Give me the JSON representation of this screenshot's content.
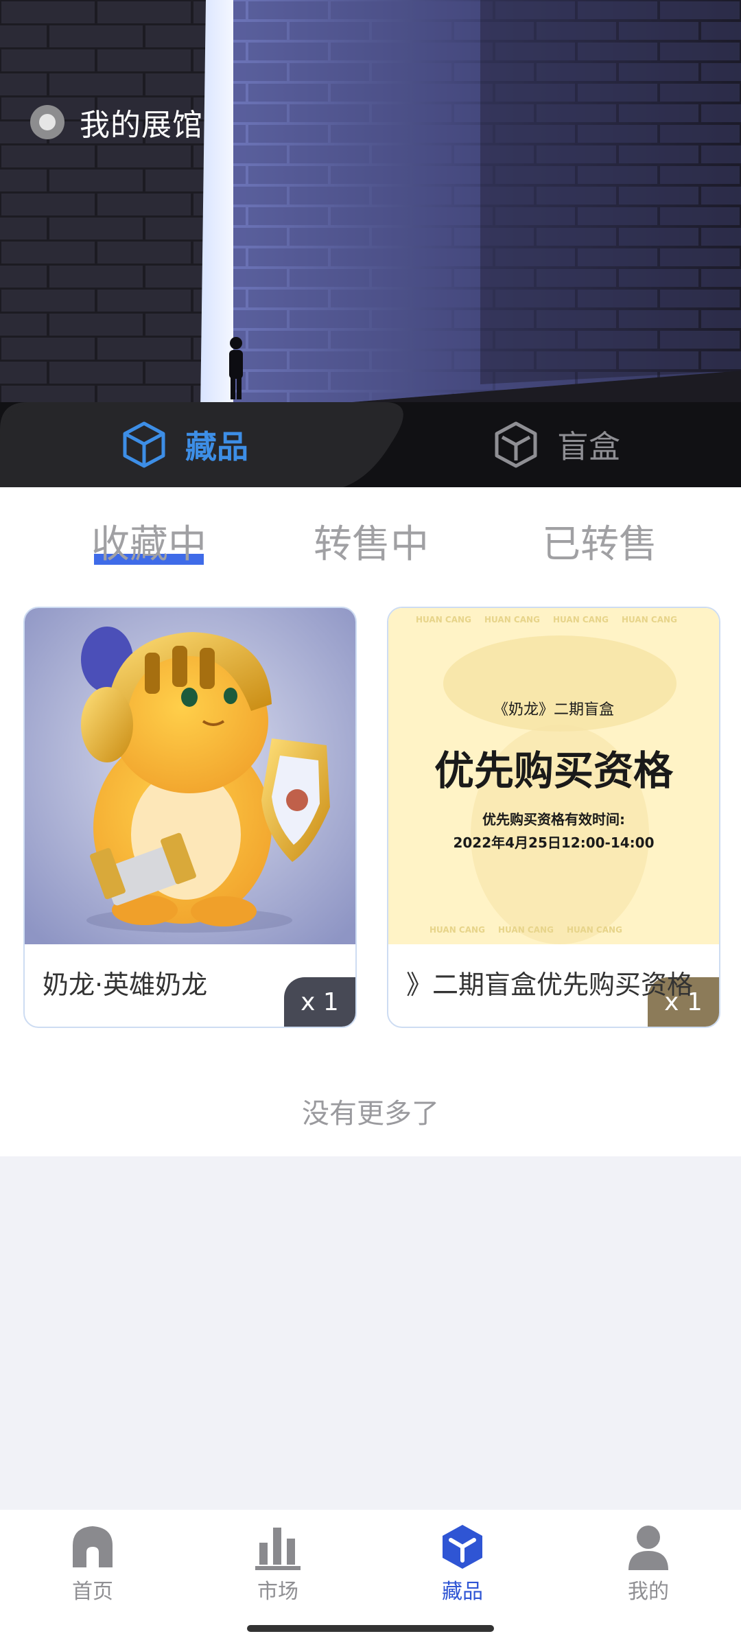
{
  "hero": {
    "title": "我的展馆"
  },
  "main_tabs": [
    {
      "label": "藏品",
      "icon": "cube-icon",
      "active": true
    },
    {
      "label": "盲盒",
      "icon": "cube-outline-icon",
      "active": false
    }
  ],
  "sub_tabs": [
    {
      "label": "收藏中",
      "active": true
    },
    {
      "label": "转售中",
      "active": false
    },
    {
      "label": "已转售",
      "active": false
    }
  ],
  "cards": [
    {
      "name": "奶龙·英雄奶龙",
      "qty": "x 1"
    },
    {
      "name": "》二期盲盒优先购买资格",
      "qty": "x 1",
      "poster": {
        "line1": "《奶龙》二期盲盒",
        "line2": "优先购买资格",
        "line3": "优先购买资格有效时间:",
        "line4": "2022年4月25日12:00-14:00",
        "watermark": "HUAN CANG"
      }
    }
  ],
  "footer_text": "没有更多了",
  "bottom_nav": [
    {
      "label": "首页",
      "icon": "home-icon",
      "active": false
    },
    {
      "label": "市场",
      "icon": "market-chart-icon",
      "active": false
    },
    {
      "label": "藏品",
      "icon": "collection-cube-icon",
      "active": true
    },
    {
      "label": "我的",
      "icon": "user-icon",
      "active": false
    }
  ],
  "colors": {
    "accent": "#3d8ee6",
    "nav_active": "#2f55d4",
    "underline": "#3f6be8"
  }
}
